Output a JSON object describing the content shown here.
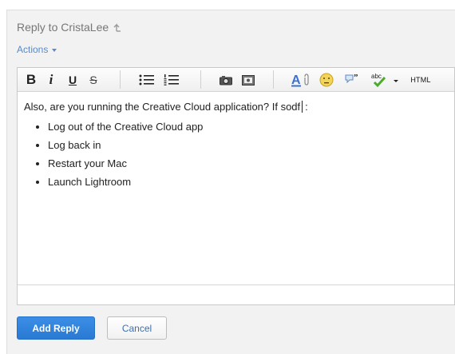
{
  "reply": {
    "title": "Reply to CristaLee",
    "actions_label": "Actions"
  },
  "toolbar": {
    "bold": "B",
    "italic": "i",
    "underline": "U",
    "strike": "S",
    "html": "HTML",
    "colors": {
      "font_color_accent": "#3b6fd0",
      "spellcheck_check": "#4caa2c",
      "emoticon": "#f3d45a"
    }
  },
  "editor": {
    "intro_before_caret": "Also, are you running the Creative Cloud application? If sodf",
    "intro_after_caret": ":",
    "list_items": [
      "Log out of the Creative Cloud app",
      "Log back in",
      "Restart your Mac",
      "Launch Lightroom"
    ]
  },
  "buttons": {
    "add_reply": "Add Reply",
    "cancel": "Cancel"
  },
  "colors": {
    "panel_bg": "#f2f2f2",
    "link": "#5b8ac6",
    "primary": "#2a79d4"
  }
}
